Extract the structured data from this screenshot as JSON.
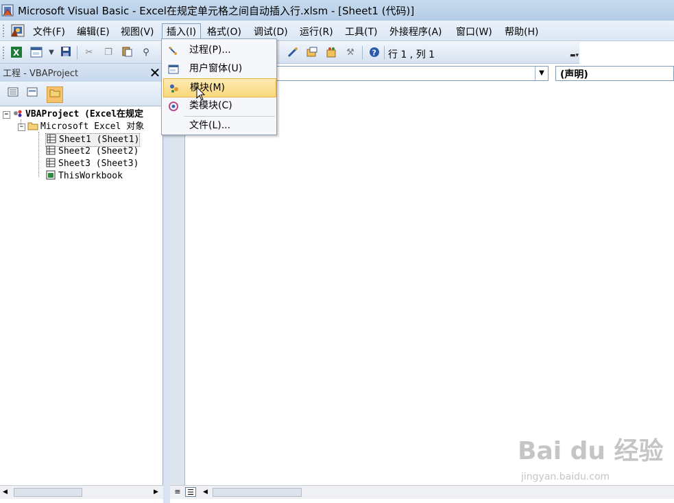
{
  "window": {
    "title": "Microsoft Visual Basic - Excel在规定单元格之间自动插入行.xlsm - [Sheet1 (代码)]"
  },
  "menubar": {
    "items": [
      {
        "label": "文件(F)"
      },
      {
        "label": "编辑(E)"
      },
      {
        "label": "视图(V)"
      },
      {
        "label": "插入(I)"
      },
      {
        "label": "格式(O)"
      },
      {
        "label": "调试(D)"
      },
      {
        "label": "运行(R)"
      },
      {
        "label": "工具(T)"
      },
      {
        "label": "外接程序(A)"
      },
      {
        "label": "窗口(W)"
      },
      {
        "label": "帮助(H)"
      }
    ],
    "active": "插入(I)"
  },
  "insert_menu": {
    "items": [
      {
        "label": "过程(P)...",
        "icon": "procedure-icon"
      },
      {
        "label": "用户窗体(U)",
        "icon": "userform-icon"
      },
      {
        "label": "模块(M)",
        "icon": "module-icon",
        "highlighted": true
      },
      {
        "label": "类模块(C)",
        "icon": "class-module-icon"
      },
      {
        "label": "文件(L)...",
        "icon": ""
      }
    ]
  },
  "toolbar": {
    "position": "行 1 , 列 1"
  },
  "project": {
    "title": "工程 - VBAProject",
    "tree": {
      "root": "VBAProject (Excel在规定",
      "folder": "Microsoft Excel 对象",
      "items": [
        "Sheet1 (Sheet1)",
        "Sheet2 (Sheet2)",
        "Sheet3 (Sheet3)",
        "ThisWorkbook"
      ]
    }
  },
  "code": {
    "object_combo": "",
    "procedure_combo": "(声明)"
  },
  "watermark": {
    "text": "Bai du 经验",
    "sub": "jingyan.baidu.com"
  },
  "colors": {
    "titlebar": "#b4cde6",
    "menu_highlight": "#f9d77b",
    "selected_toolbar_button": "#f7c36a"
  }
}
